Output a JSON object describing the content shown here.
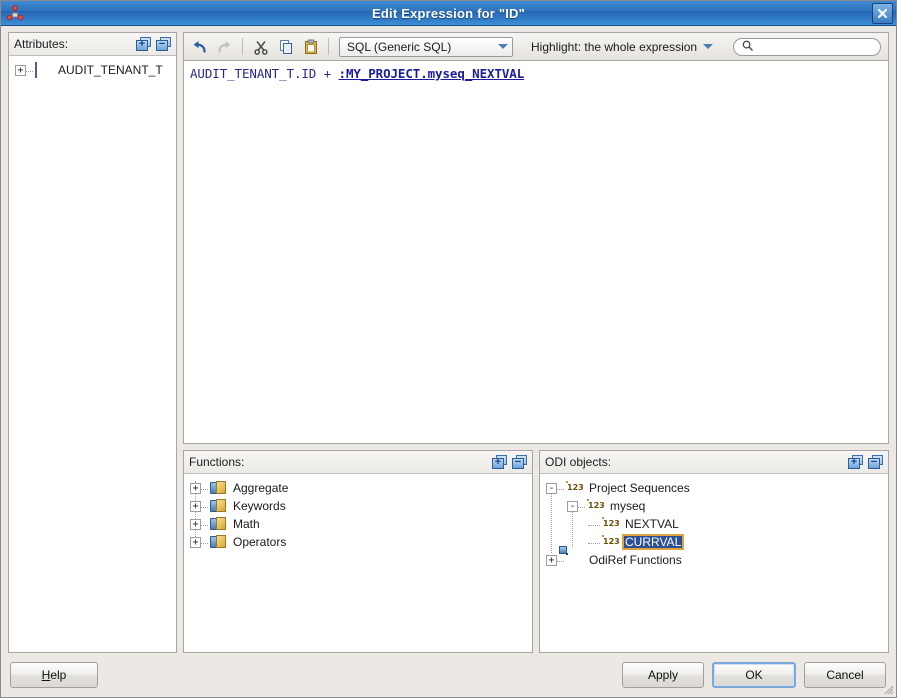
{
  "window": {
    "title": "Edit Expression for \"ID\"",
    "icon": "expression-node-icon",
    "close_label": "✖"
  },
  "attributes_panel": {
    "title": "Attributes:",
    "expand_icon": "expand-all-icon",
    "collapse_icon": "collapse-all-icon",
    "tree": [
      {
        "label": "AUDIT_TENANT_T",
        "toggle": "+",
        "icon": "table-icon",
        "level": 0
      }
    ]
  },
  "toolbar": {
    "undo_icon": "undo-icon",
    "redo_icon": "redo-icon",
    "cut_icon": "cut-scissors-icon",
    "copy_icon": "copy-icon",
    "paste_icon": "paste-icon",
    "language_value": "SQL (Generic SQL)",
    "highlight_value": "Highlight: the whole expression",
    "search_placeholder": "",
    "search_value": "",
    "search_icon": "search-icon"
  },
  "expression": {
    "plain": "AUDIT_TENANT_T.ID + ",
    "reference": ":MY_PROJECT.myseq_NEXTVAL",
    "full_text": "AUDIT_TENANT_T.ID + :MY_PROJECT.myseq_NEXTVAL"
  },
  "functions_panel": {
    "title": "Functions:",
    "expand_icon": "expand-all-icon",
    "collapse_icon": "collapse-all-icon",
    "tree": [
      {
        "label": "Aggregate",
        "toggle": "+",
        "icon": "function-icon",
        "level": 0
      },
      {
        "label": "Keywords",
        "toggle": "+",
        "icon": "function-icon",
        "level": 0
      },
      {
        "label": "Math",
        "toggle": "+",
        "icon": "function-icon",
        "level": 0
      },
      {
        "label": "Operators",
        "toggle": "+",
        "icon": "function-icon",
        "level": 0
      }
    ]
  },
  "odi_objects_panel": {
    "title": "ODI objects:",
    "expand_icon": "expand-all-icon",
    "collapse_icon": "collapse-all-icon",
    "tree": [
      {
        "label": "Project Sequences",
        "toggle": "-",
        "icon": "sequence-icon",
        "level": 0,
        "selected": false
      },
      {
        "label": "myseq",
        "toggle": "-",
        "icon": "sequence-icon",
        "level": 1,
        "selected": false
      },
      {
        "label": "NEXTVAL",
        "toggle": "",
        "icon": "sequence-icon",
        "level": 2,
        "selected": false
      },
      {
        "label": "CURRVAL",
        "toggle": "",
        "icon": "sequence-icon",
        "level": 2,
        "selected": true
      },
      {
        "label": "OdiRef Functions",
        "toggle": "+",
        "icon": "odiref-icon",
        "level": 0,
        "selected": false
      }
    ]
  },
  "buttons": {
    "help": "Help",
    "help_mnemonic": "H",
    "help_rest": "elp",
    "apply": "Apply",
    "ok": "OK",
    "cancel": "Cancel"
  },
  "colors": {
    "title_bar": "#2f73bd",
    "selection": "#2a4f92",
    "selection_outline": "#e0a33c",
    "expression_text": "#262680",
    "dialog_bg": "#ece9e4"
  }
}
